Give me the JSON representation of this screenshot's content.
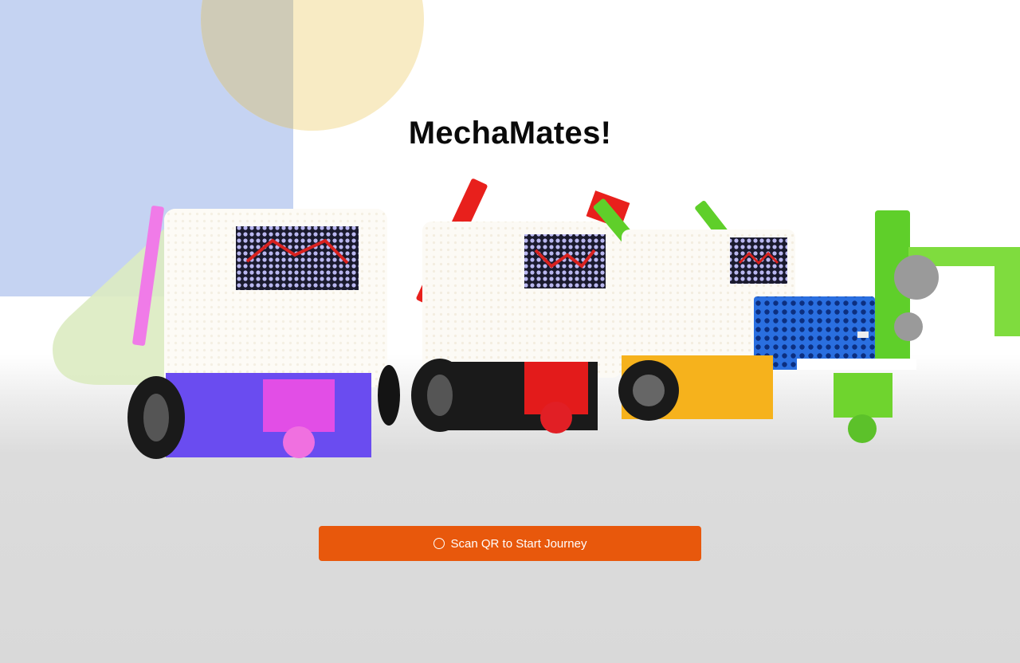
{
  "title": "MechaMates!",
  "cta": {
    "label": "Scan QR to Start Journey",
    "icon": "circle-icon"
  },
  "hero": {
    "subject": "robot-group-image"
  },
  "colors": {
    "accent": "#e8580c",
    "deco_blue": "#c5d3f2",
    "deco_yellow": "#f8ebc4",
    "deco_green": "#dcebc1"
  }
}
